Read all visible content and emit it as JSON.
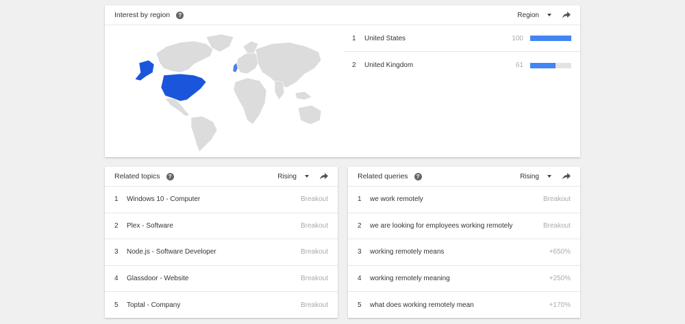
{
  "region_card": {
    "title": "Interest by region",
    "selector": "Region",
    "rows": [
      {
        "rank": "1",
        "name": "United States",
        "value": "100",
        "level": 100
      },
      {
        "rank": "2",
        "name": "United Kingdom",
        "value": "61",
        "level": 61
      }
    ],
    "colors": {
      "highlight": "#1a56db",
      "land": "#dcdcdc",
      "bar": "#4285f4",
      "track": "#e3e3e3"
    }
  },
  "topics_card": {
    "title": "Related topics",
    "selector": "Rising",
    "rows": [
      {
        "rank": "1",
        "label": "Windows 10 - Computer",
        "value": "Breakout"
      },
      {
        "rank": "2",
        "label": "Plex - Software",
        "value": "Breakout"
      },
      {
        "rank": "3",
        "label": "Node.js - Software Developer",
        "value": "Breakout"
      },
      {
        "rank": "4",
        "label": "Glassdoor - Website",
        "value": "Breakout"
      },
      {
        "rank": "5",
        "label": "Toptal - Company",
        "value": "Breakout"
      }
    ]
  },
  "queries_card": {
    "title": "Related queries",
    "selector": "Rising",
    "rows": [
      {
        "rank": "1",
        "label": "we work remotely",
        "value": "Breakout"
      },
      {
        "rank": "2",
        "label": "we are looking for employees working remotely",
        "value": "Breakout"
      },
      {
        "rank": "3",
        "label": "working remotely means",
        "value": "+650%"
      },
      {
        "rank": "4",
        "label": "working remotely meaning",
        "value": "+250%"
      },
      {
        "rank": "5",
        "label": "what does working remotely mean",
        "value": "+170%"
      }
    ]
  },
  "icons": {
    "help": "help-circle-icon",
    "dropdown": "caret-down-icon",
    "share": "share-arrow-icon"
  }
}
